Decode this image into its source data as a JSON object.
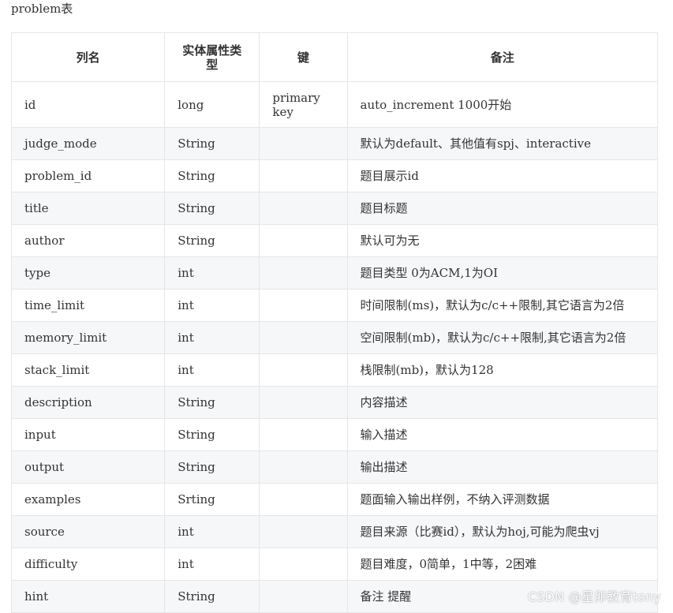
{
  "document": {
    "title": "problem表"
  },
  "table": {
    "headers": [
      "列名",
      "实体属性类型",
      "键",
      "备注"
    ],
    "rows": [
      {
        "name": "id",
        "type": "long",
        "key": "primary key",
        "note": "auto_increment 1000开始"
      },
      {
        "name": "judge_mode",
        "type": "String",
        "key": "",
        "note": "默认为default、其他值有spj、interactive"
      },
      {
        "name": "problem_id",
        "type": "String",
        "key": "",
        "note": "题目展示id"
      },
      {
        "name": "title",
        "type": "String",
        "key": "",
        "note": "题目标题"
      },
      {
        "name": "author",
        "type": "String",
        "key": "",
        "note": "默认可为无"
      },
      {
        "name": "type",
        "type": "int",
        "key": "",
        "note": "题目类型 0为ACM,1为OI"
      },
      {
        "name": "time_limit",
        "type": "int",
        "key": "",
        "note": "时间限制(ms)，默认为c/c++限制,其它语言为2倍"
      },
      {
        "name": "memory_limit",
        "type": "int",
        "key": "",
        "note": "空间限制(mb)，默认为c/c++限制,其它语言为2倍"
      },
      {
        "name": "stack_limit",
        "type": "int",
        "key": "",
        "note": "栈限制(mb)，默认为128"
      },
      {
        "name": "description",
        "type": "String",
        "key": "",
        "note": "内容描述"
      },
      {
        "name": "input",
        "type": "String",
        "key": "",
        "note": "输入描述"
      },
      {
        "name": "output",
        "type": "String",
        "key": "",
        "note": "输出描述"
      },
      {
        "name": "examples",
        "type": "Srting",
        "key": "",
        "note": "题面输入输出样例，不纳入评测数据"
      },
      {
        "name": "source",
        "type": "int",
        "key": "",
        "note": "题目来源（比赛id），默认为hoj,可能为爬虫vj"
      },
      {
        "name": "difficulty",
        "type": "int",
        "key": "",
        "note": "题目难度，0简单，1中等，2困难"
      },
      {
        "name": "hint",
        "type": "String",
        "key": "",
        "note": "备注 提醒"
      }
    ]
  },
  "watermark": {
    "text": "CSDN @星卯教育tony"
  }
}
